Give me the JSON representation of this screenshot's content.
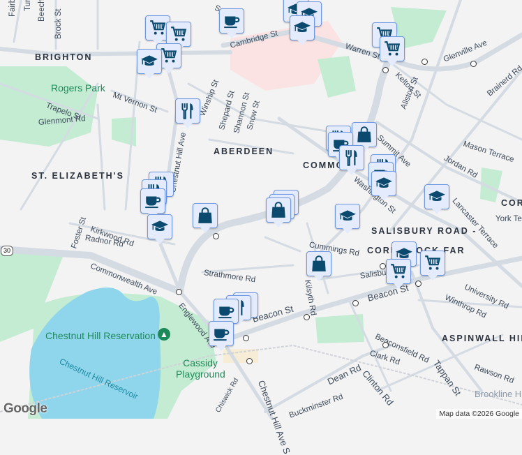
{
  "map": {
    "neighborhoods": [
      "BRIGHTON",
      "ABERDEEN",
      "ST. ELIZABETH'S",
      "COMMONWEALTH",
      "SALISBURY ROAD -",
      "CORE BLOCK FARM",
      "ASPINWALL HILL",
      "CORE"
    ],
    "parks": [
      "Rogers Park",
      "Chestnut Hill Reservation",
      "Cassidy Playground",
      "Brookline Hills"
    ],
    "water": [
      "Chestnut Hill Reservoir"
    ],
    "streets": [
      "Fairbanks St",
      "Turner St",
      "Beechcroft St",
      "Brock St",
      "Spark St",
      "Cambridge St",
      "Warren St",
      "Kelton St",
      "Glenville Ave",
      "Brainerd Rd",
      "Allston St",
      "Summit Ave",
      "Mason Terrace",
      "Jordan Rd",
      "Washington St",
      "Lancaster Terrace",
      "York Terrace",
      "Mt Vernon St",
      "Trapelo St",
      "Glenmont Rd",
      "Kilsyth Rd",
      "Winship St",
      "Shepard St",
      "Shannon St",
      "Snow St",
      "Chestnut Hill Ave",
      "Foster St",
      "Kirkwood Rd",
      "Radnor Rd",
      "Commonwealth Ave",
      "Strathmore Rd",
      "Cummings Rd",
      "Salisbury Rd",
      "University Rd",
      "Winthrop Rd",
      "Beacon St",
      "Beaconsfield Rd",
      "Clark Rd",
      "Tappan St",
      "Rawson Rd",
      "Dean Rd",
      "Clinton Rd",
      "Buckminster Rd",
      "Chestnut Hill Ave S",
      "Englewood Ave",
      "Chiswick Rd"
    ],
    "route_shield": "30",
    "attribution": "Map data ©2026 Google",
    "logo": "Google"
  },
  "icons": {
    "grocery": "shopping-cart-icon",
    "cafe": "coffee-cup-icon",
    "school": "graduation-cap-icon",
    "restaurant": "fork-knife-icon",
    "shopping": "shopping-bag-icon",
    "park": "tree-icon",
    "transit": "transit-stop-icon"
  },
  "colors": {
    "background": "#f4f3f4",
    "road": "#d4dbe3",
    "park": "#c3ecd2",
    "water": "#8fd6ec",
    "hospital": "#fbe3e3",
    "marker_fill": "#e3ebfc",
    "marker_border": "#6e98e0",
    "icon": "#0b4a6e"
  }
}
